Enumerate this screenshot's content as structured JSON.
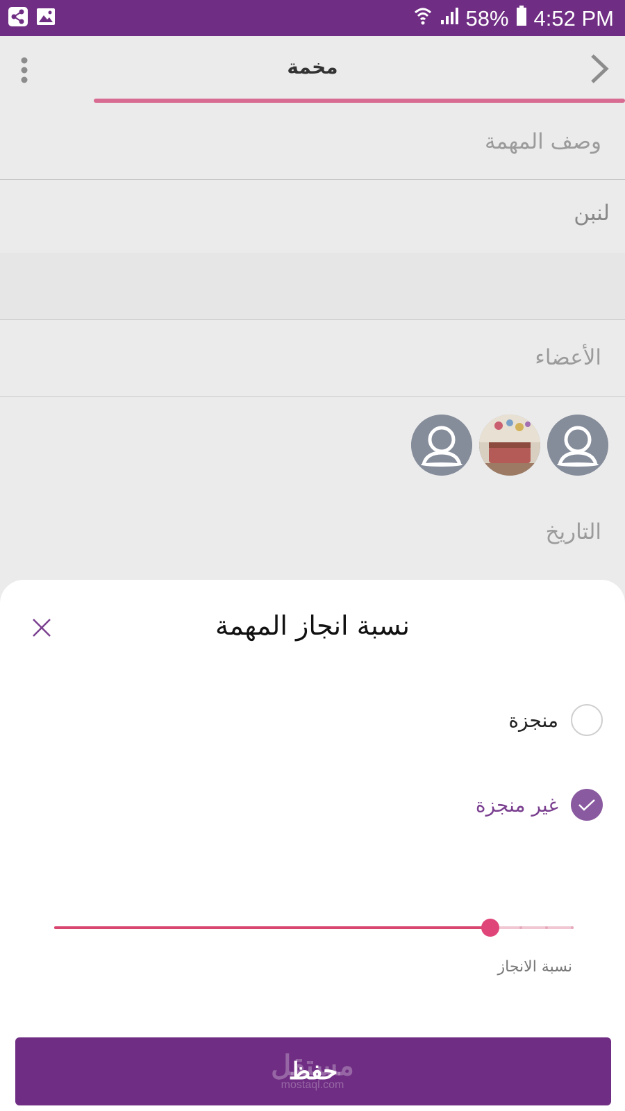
{
  "status_bar": {
    "battery": "58%",
    "time": "4:52 PM"
  },
  "app_bar": {
    "title": "مخمة"
  },
  "form": {
    "description_label": "وصف المهمة",
    "description_value": "لنبن",
    "members_label": "الأعضاء",
    "date_label": "التاريخ"
  },
  "members": [
    {
      "icon": "avatar-placeholder-icon"
    },
    {
      "icon": "avatar-photo"
    },
    {
      "icon": "avatar-placeholder-icon"
    }
  ],
  "sheet": {
    "title": "نسبة انجاز المهمة",
    "options": [
      {
        "label": "منجزة",
        "selected": false
      },
      {
        "label": "غير منجزة",
        "selected": true
      }
    ],
    "slider_label": "نسبة الانجاز",
    "slider_value_fraction": 0.84,
    "save_label": "حفظ"
  },
  "watermark": {
    "arabic": "مستقل",
    "latin": "mostaql.com"
  },
  "colors": {
    "primary": "#6f2d83",
    "accent": "#d86b91",
    "radio_checked": "#8a5aa0"
  }
}
